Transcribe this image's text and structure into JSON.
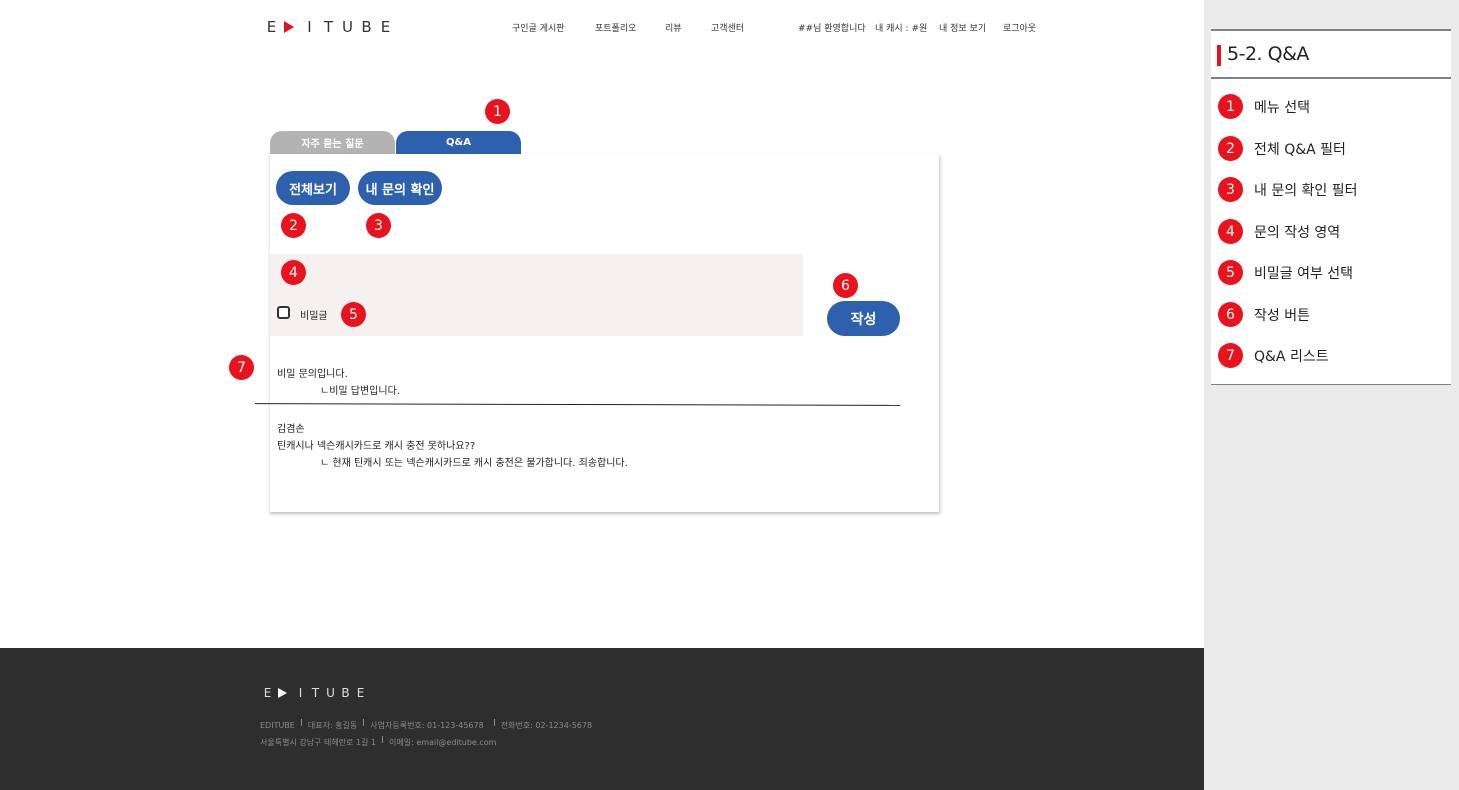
{
  "header": {
    "logo_letters": [
      "E",
      "I",
      "T",
      "U",
      "B",
      "E"
    ],
    "nav": {
      "job_board": "구인글 게시판",
      "portfolio": "포트폴리오",
      "review": "리뷰",
      "support": "고객센터",
      "welcome": "##님 환영합니다",
      "my_cash": "내 캐시 : #원",
      "my_info": "내 정보 보기",
      "logout": "로그아웃"
    }
  },
  "tabs": {
    "faq": "자주 묻는 질문",
    "qa": "Q&A"
  },
  "filters": {
    "all": "전체보기",
    "mine": "내 문의 확인"
  },
  "write": {
    "secret_label": "비밀글",
    "submit": "작성",
    "secret_checked": false
  },
  "qa_list": [
    {
      "question": "비밀 문의입니다.",
      "answer": "ㄴ비밀 답변입니다."
    },
    {
      "author": "김겸손",
      "question": "틴캐시나 넥슨캐시카드로 캐시 충전 못하나요??",
      "answer": "ㄴ 현재 틴캐시 또는 넥슨캐시카드로 캐시 충전은 불가합니다. 죄송합니다."
    }
  ],
  "markers": [
    "1",
    "2",
    "3",
    "4",
    "5",
    "6",
    "7"
  ],
  "footer": {
    "logo_letters": [
      "E",
      "I",
      "T",
      "U",
      "B",
      "E"
    ],
    "company": "EDITUBE",
    "ceo": "대표자: 홍길동",
    "biz_no": "사업자등록번호: 01-123-45678",
    "phone": "전화번호: 02-1234-5678",
    "address": "서울특별시 강남구 테헤란로 1길 1",
    "email": "이메일: email@editube.com"
  },
  "panel": {
    "title": "5-2. Q&A",
    "items": [
      {
        "num": "1",
        "label": "메뉴 선택"
      },
      {
        "num": "2",
        "label": "전체 Q&A 필터"
      },
      {
        "num": "3",
        "label": "내 문의 확인 필터"
      },
      {
        "num": "4",
        "label": "문의 작성 영역"
      },
      {
        "num": "5",
        "label": "비밀글 여부 선택"
      },
      {
        "num": "6",
        "label": "작성 버튼"
      },
      {
        "num": "7",
        "label": "Q&A 리스트"
      }
    ]
  },
  "colors": {
    "accent_blue": "#2d61ae",
    "marker_red": "#e8131d",
    "tab_inactive": "#b3b3b3",
    "footer_bg": "#2e2e2e",
    "write_area_bg": "#f4f1f0",
    "panel_bg": "#ebebeb"
  },
  "icons": {
    "logo_play": "play-triangle-icon",
    "secret_checkbox": "checkbox-icon"
  }
}
